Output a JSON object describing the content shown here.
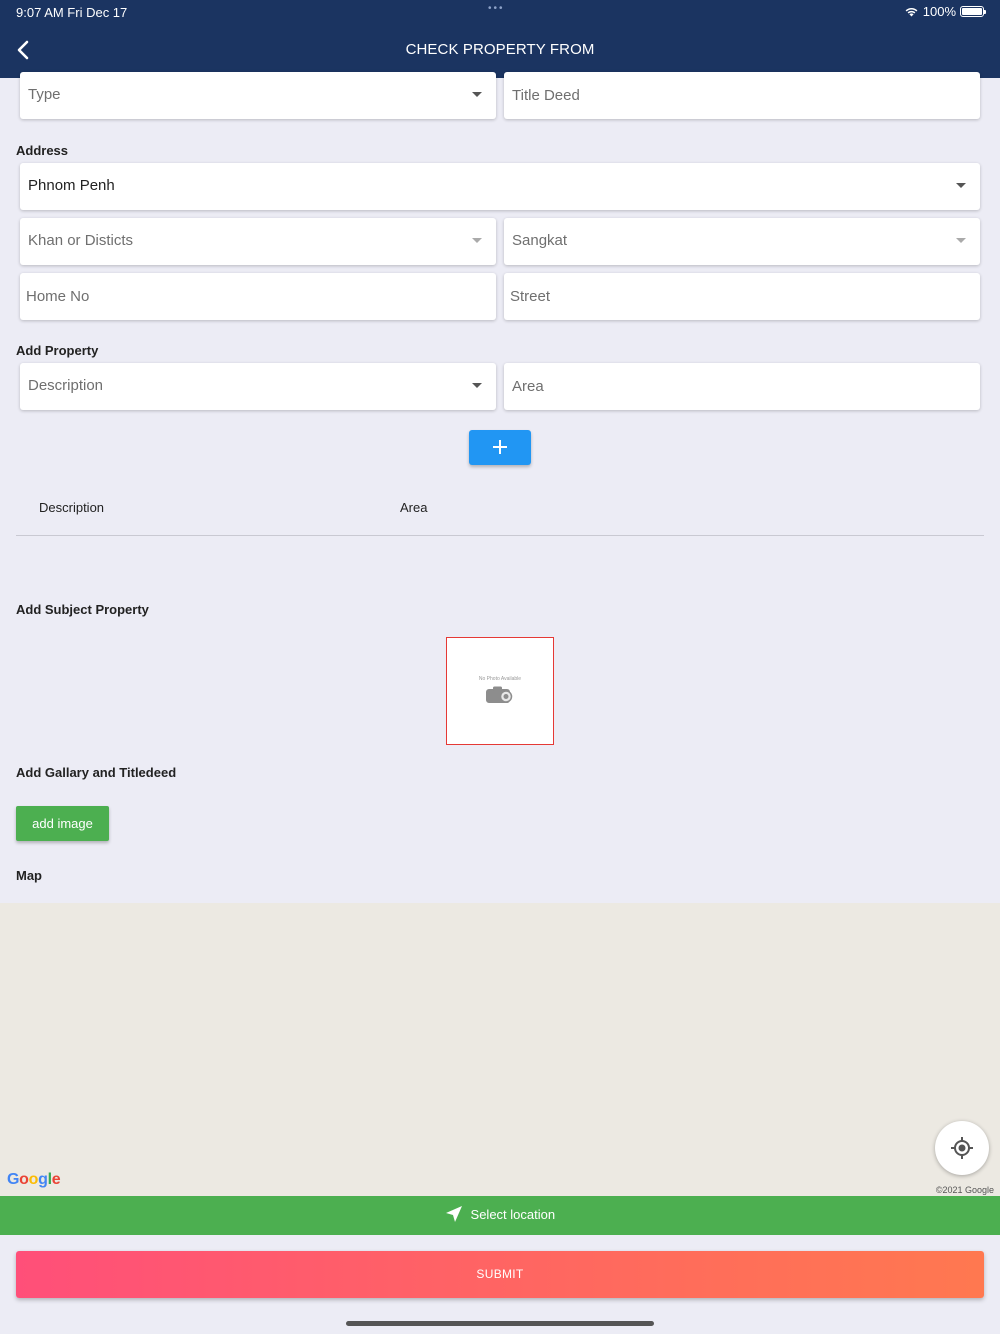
{
  "status_bar": {
    "time": "9:07 AM   Fri Dec 17",
    "battery": "100%"
  },
  "nav": {
    "title": "CHECK PROPERTY FROM"
  },
  "top_row": {
    "type_placeholder": "Type",
    "title_deed_placeholder": "Title Deed"
  },
  "address": {
    "label": "Address",
    "city": "Phnom Penh",
    "khan_placeholder": "Khan or Disticts",
    "sangkat_placeholder": "Sangkat",
    "home_no_placeholder": "Home No",
    "street_placeholder": "Street"
  },
  "add_property": {
    "label": "Add Property",
    "description_placeholder": "Description",
    "area_placeholder": "Area",
    "table_headers": {
      "description": "Description",
      "area": "Area"
    }
  },
  "subject_property": {
    "label": "Add Subject Property",
    "no_photo_text": "No Photo Available"
  },
  "gallery": {
    "label": "Add Gallary and Titledeed",
    "add_image_label": "add image"
  },
  "map": {
    "label": "Map",
    "logo": "Google",
    "copyright": "©2021 Google"
  },
  "select_location_label": "Select location",
  "submit_label": "SUBMIT",
  "colors": {
    "nav": "#1b3461",
    "accent_blue": "#2196f3",
    "green": "#4caf50",
    "submit_start": "#ff4f79",
    "submit_end": "#ff7850"
  }
}
